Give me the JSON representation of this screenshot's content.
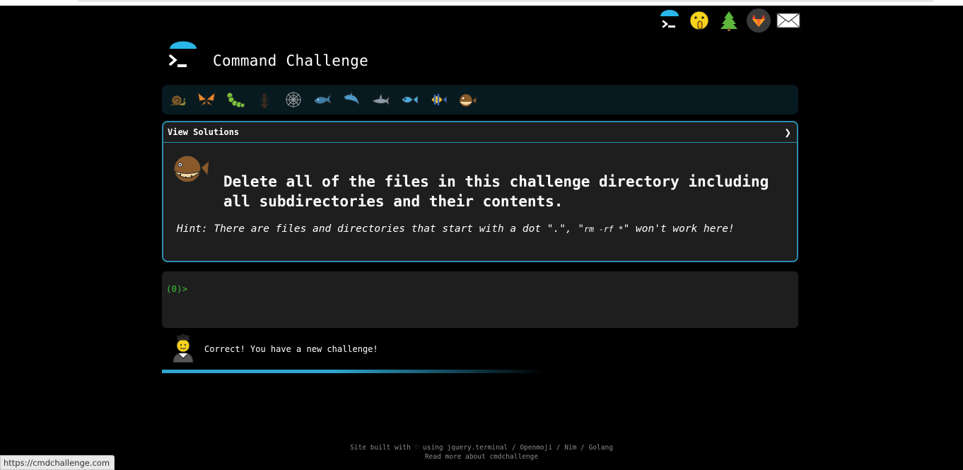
{
  "top_icons": [
    "terminal-umbrella-icon",
    "shushing-face-icon",
    "tree-icon",
    "gitlab-icon",
    "envelope-icon"
  ],
  "site": {
    "title": "Command Challenge"
  },
  "badges": [
    "snail-icon",
    "butterfly-icon",
    "caterpillar-icon",
    "ant-icon",
    "spider-web-icon",
    "whale-icon",
    "dolphin-icon",
    "shark-icon",
    "fish-icon",
    "tropical-fish-icon",
    "blowfish-icon"
  ],
  "challenge": {
    "view_solutions": "View Solutions",
    "chevron": "❯",
    "text": "Delete all of the files in this challenge directory including all subdirectories and their contents.",
    "hint_prefix": "Hint: There are files and directories that start with a dot \".\", \"",
    "hint_code": "rm -rf *",
    "hint_suffix": "\" won't work here!"
  },
  "terminal": {
    "prompt": "(0)>"
  },
  "feedback": {
    "message": "Correct! You have a new challenge!",
    "progress_fraction": 0.45
  },
  "footer": {
    "line1_prefix": "Site built with ♡ using ",
    "link_jquery": "jquery.terminal",
    "sep1": " / ",
    "link_openmoji": "Openmoji",
    "sep2": " / ",
    "link_nim": "Nim",
    "sep3": " / ",
    "link_golang": "Golang",
    "line2": "Read more about cmdchallenge"
  },
  "statusbar": {
    "url": "https://cmdchallenge.com"
  },
  "colors": {
    "accent": "#2b8fb0",
    "prompt": "#3ac43a",
    "panel": "#1e1e1e",
    "badge_bar": "#071a20"
  }
}
